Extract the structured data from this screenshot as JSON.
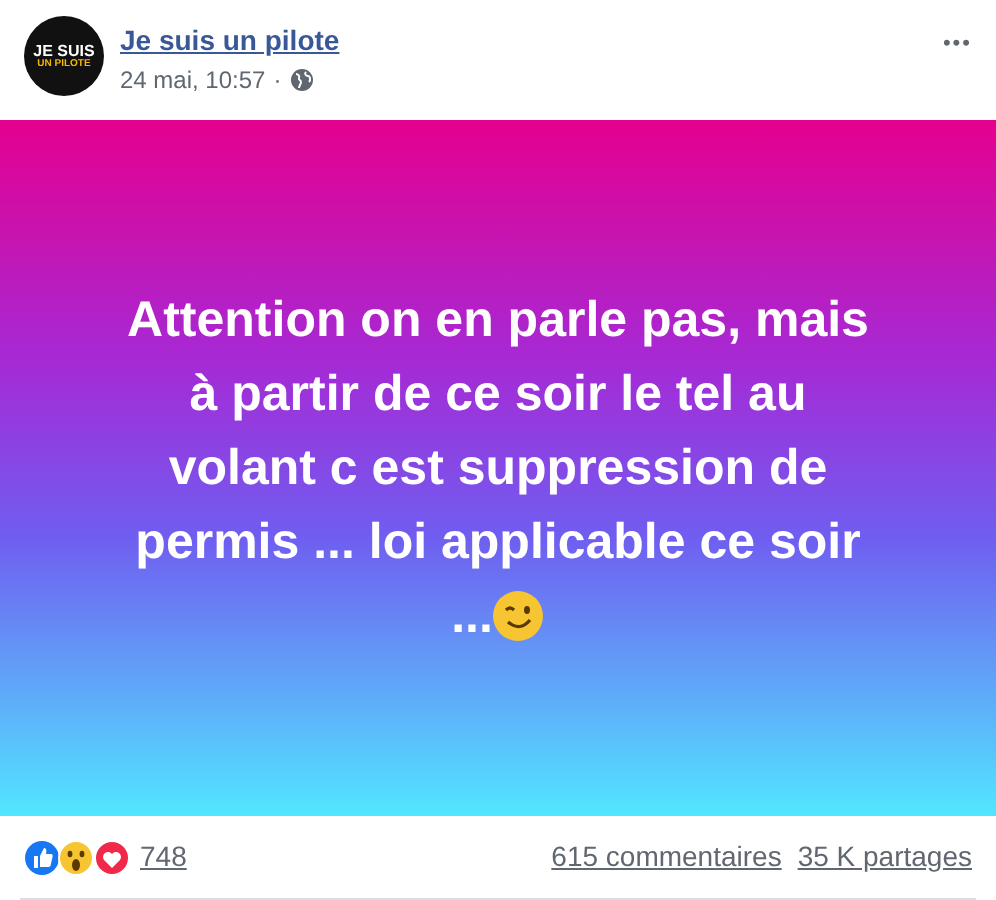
{
  "post": {
    "author": "Je suis un pilote",
    "avatar_text": [
      "JE SUIS",
      "UN PILOTE"
    ],
    "time": "24 mai, 10:57",
    "separator": "·",
    "menu": "•••",
    "text_lines": [
      "Attention on en parle pas, mais",
      "à partir de ce soir le tel au",
      "volant c est suppression de",
      "permis ... loi applicable ce soir",
      "..."
    ],
    "reaction_count": "748",
    "comments": "615 commentaires",
    "shares": "35 K partages"
  }
}
